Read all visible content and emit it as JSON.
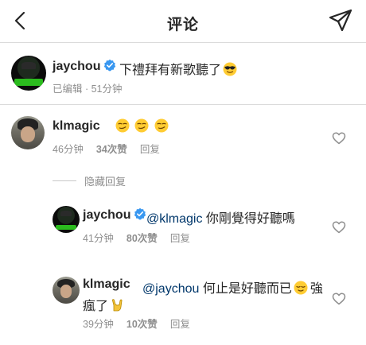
{
  "header": {
    "back_icon": "chevron-left-icon",
    "title": "评论",
    "share_icon": "paper-plane-icon"
  },
  "caption": {
    "username": "jaychou",
    "text": "下禮拜有新歌聽了",
    "emoji": "😎",
    "meta": "已编辑 · 51分钟"
  },
  "comments": [
    {
      "username": "klmagic",
      "text": "",
      "emojis": [
        "😏",
        "😏",
        "😏"
      ],
      "time": "46分钟",
      "likes": "34次赞",
      "reply": "回复"
    }
  ],
  "hidden_replies": {
    "label": "隐藏回复"
  },
  "replies": [
    {
      "username": "jaychou",
      "mention": "@klmagic",
      "text": " 你剛覺得好聽嗎",
      "time": "41分钟",
      "likes": "80次赞",
      "reply": "回复"
    },
    {
      "username": "klmagic",
      "mention": "@jaychou",
      "text": " 何止是好聽而已",
      "emoji": "😌",
      "text2": "強",
      "line2": "瘋了",
      "emoji2": "🤘",
      "time": "39分钟",
      "likes": "10次赞",
      "reply": "回复"
    }
  ],
  "colors": {
    "text": "#262626",
    "secondary": "#8e8e8e",
    "mention": "#00376b",
    "verified": "#3897f0",
    "divider": "#dbdbdb"
  }
}
